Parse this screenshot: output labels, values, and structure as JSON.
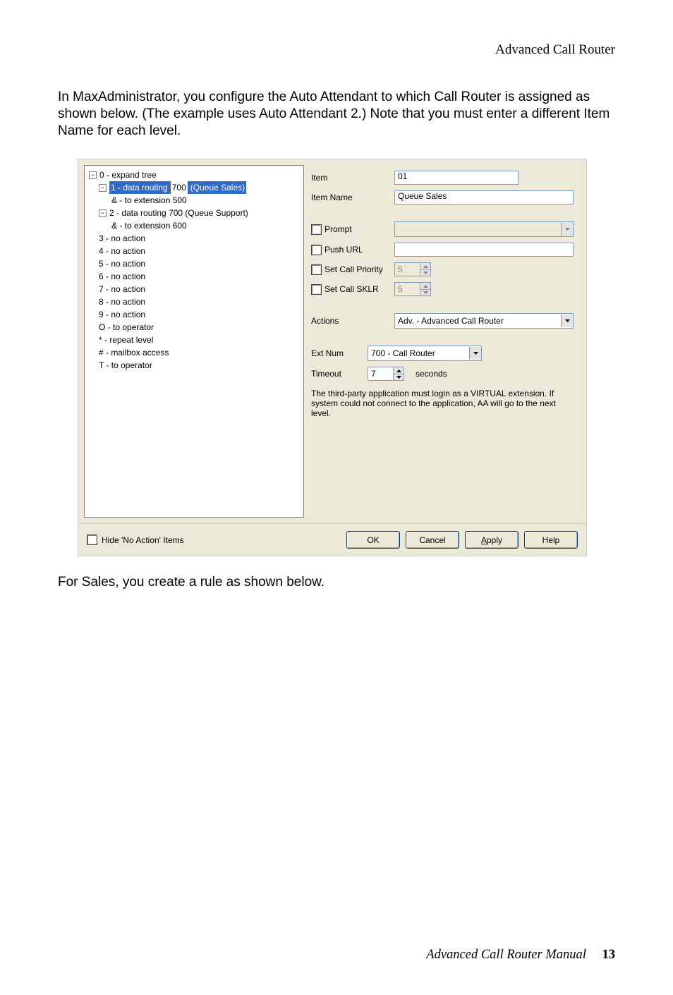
{
  "page": {
    "header": "Advanced Call Router",
    "intro": "In MaxAdministrator, you configure the Auto Attendant to which Call Router is assigned as shown below. (The example uses Auto Attendant 2.) Note that you must enter a different Item Name for each level.",
    "post_text": "For Sales, you create a rule as shown below.",
    "footer_title": "Advanced Call Router Manual",
    "footer_page": "13"
  },
  "tree": {
    "n0": "0 - expand tree",
    "n1_a": "1 - data routing",
    "n1_b": "700",
    "n1_c": "(Queue Sales)",
    "n1_child": "& - to extension 500",
    "n2": "2 - data routing 700   (Queue Support)",
    "n2_child": "& - to extension 600",
    "n3": "3 - no action",
    "n4": "4 - no action",
    "n5": "5 - no action",
    "n6": "6 - no action",
    "n7": "7 - no action",
    "n8": "8 - no action",
    "n9": "9 - no action",
    "nO": "O - to operator",
    "nStar": "* - repeat level",
    "nHash": "# - mailbox access",
    "nT": "T - to operator"
  },
  "form": {
    "item_label": "Item",
    "item_value": "01",
    "itemname_label": "Item Name",
    "itemname_value": "Queue Sales",
    "prompt_label": "Prompt",
    "pushurl_label": "Push URL",
    "setcallpriority_label": "Set Call Priority",
    "setcallpriority_value": "5",
    "setcallsklr_label": "Set Call SKLR",
    "setcallsklr_value": "5",
    "actions_label": "Actions",
    "actions_value": "Adv. - Advanced Call Router",
    "extnum_label": "Ext Num",
    "extnum_value": "700 - Call Router",
    "timeout_label": "Timeout",
    "timeout_value": "7",
    "seconds_label": "seconds",
    "help_text": "The third-party application must login as a VIRTUAL extension. If system could not connect to the application, AA will go to the next level."
  },
  "footer": {
    "hide_label": "Hide 'No Action' Items",
    "ok": "OK",
    "cancel": "Cancel",
    "apply_pre": "A",
    "apply_post": "pply",
    "help": "Help"
  }
}
